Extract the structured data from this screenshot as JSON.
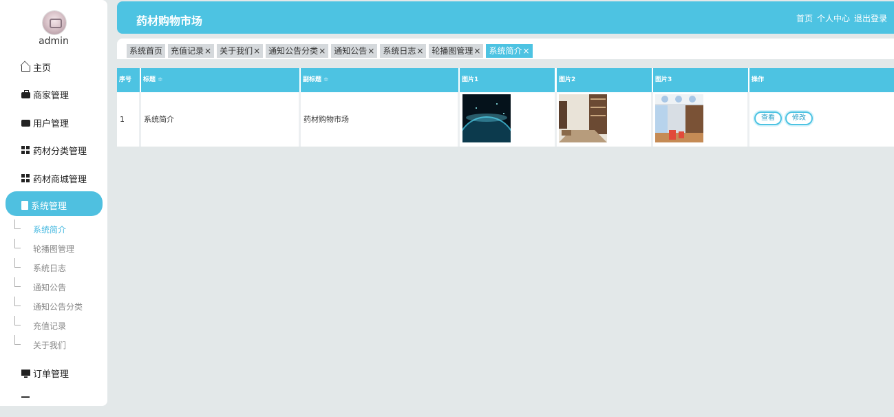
{
  "sidebar": {
    "user": "admin",
    "menu": [
      {
        "label": "主页",
        "icon": "home-icon"
      },
      {
        "label": "商家管理",
        "icon": "briefcase-icon"
      },
      {
        "label": "用户管理",
        "icon": "chat-icon"
      },
      {
        "label": "药材分类管理",
        "icon": "grid-icon"
      },
      {
        "label": "药材商城管理",
        "icon": "grid-icon"
      },
      {
        "label": "系统管理",
        "icon": "clipboard-icon"
      },
      {
        "label": "订单管理",
        "icon": "monitor-icon"
      }
    ],
    "submenu": [
      "系统简介",
      "轮播图管理",
      "系统日志",
      "通知公告",
      "通知公告分类",
      "充值记录",
      "关于我们"
    ]
  },
  "header": {
    "title": "药材购物市场",
    "links": [
      "首页",
      "个人中心",
      "退出登录"
    ]
  },
  "tabs": [
    {
      "label": "系统首页",
      "closable": false
    },
    {
      "label": "充值记录",
      "closable": true
    },
    {
      "label": "关于我们",
      "closable": true
    },
    {
      "label": "通知公告分类",
      "closable": true
    },
    {
      "label": "通知公告",
      "closable": true
    },
    {
      "label": "系统日志",
      "closable": true
    },
    {
      "label": "轮播图管理",
      "closable": true
    },
    {
      "label": "系统简介",
      "closable": true,
      "active": true
    }
  ],
  "tab_close_glyph": "×",
  "table": {
    "columns": [
      "序号",
      "标题",
      "副标题",
      "图片1",
      "图片2",
      "图片3",
      "操作"
    ],
    "sort_glyph": "≑",
    "rows": [
      {
        "index": "1",
        "title": "系统简介",
        "subtitle": "药材购物市场"
      }
    ],
    "actions": [
      "查看",
      "修改"
    ]
  },
  "colors": {
    "accent": "#4dc3e2",
    "background": "#e3e8e9"
  }
}
